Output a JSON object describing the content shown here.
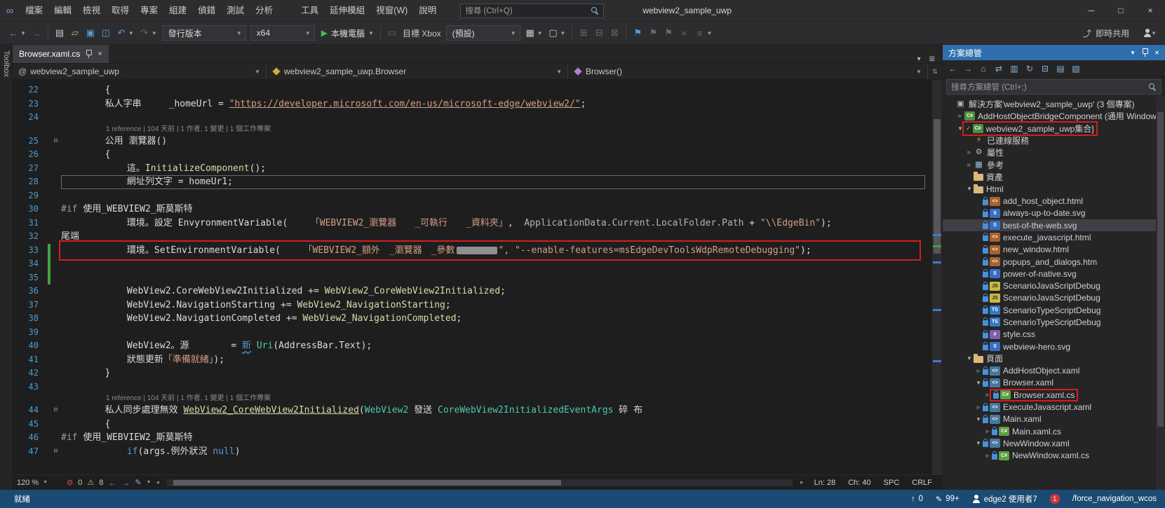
{
  "colors": {
    "annot": "#d21e1e",
    "accent": "#2f6fad",
    "status": "#1b4a74",
    "kw": "#569cd6",
    "str": "#d69d85",
    "typ": "#4ec9b0",
    "mth": "#dcdcaa",
    "run_green": "#3fbf49"
  },
  "titlebar": {
    "title": "webview2_sample_uwp",
    "search": "搜尋 (Ctrl+Q)",
    "menus": [
      {
        "id": "file",
        "label": "檔案"
      },
      {
        "id": "edit",
        "label": "編輯"
      },
      {
        "id": "view",
        "label": "檢視"
      },
      {
        "id": "get",
        "label": "取得"
      },
      {
        "id": "project",
        "label": "專案"
      },
      {
        "id": "build",
        "label": "組建"
      },
      {
        "id": "debug",
        "label": "偵錯"
      },
      {
        "id": "test",
        "label": "測試"
      },
      {
        "id": "analyze",
        "label": "分析"
      },
      {
        "id": "tools",
        "label": "工具",
        "gap": true
      },
      {
        "id": "extensions",
        "label": "延伸模組"
      },
      {
        "id": "window",
        "label": "視窗(W)"
      },
      {
        "id": "help",
        "label": "說明"
      }
    ],
    "window_buttons": {
      "minimize": "─",
      "maximize": "□",
      "close": "×"
    }
  },
  "toolbar": {
    "config": "發行版本",
    "arch": "x64",
    "run_label": "本機電腦",
    "target_label": "目標 Xbox",
    "profile_label": "(預設)",
    "liveshare_label": "即時共用",
    "items": [
      {
        "t": "icon",
        "n": "nav-backward-icon",
        "g": "←",
        "c": "blue"
      },
      {
        "t": "caret"
      },
      {
        "t": "icon",
        "n": "nav-forward-icon",
        "g": "→",
        "c": "dim"
      },
      {
        "t": "sep"
      },
      {
        "t": "icon",
        "n": "new-file-icon",
        "g": "▤",
        "c": ""
      },
      {
        "t": "icon",
        "n": "open-file-icon",
        "g": "▱",
        "c": "tan"
      },
      {
        "t": "icon",
        "n": "save-icon",
        "g": "▣",
        "c": "blue"
      },
      {
        "t": "icon",
        "n": "save-all-icon",
        "g": "◫",
        "c": "blue"
      },
      {
        "t": "icon",
        "n": "undo-icon",
        "g": "↶",
        "c": "blue"
      },
      {
        "t": "caret"
      },
      {
        "t": "icon",
        "n": "redo-icon",
        "g": "↷",
        "c": "dim"
      },
      {
        "t": "caret"
      },
      {
        "t": "combo",
        "n": "solution-configuration-combo",
        "bind": "config",
        "cls": "cfg"
      },
      {
        "t": "combo",
        "n": "solution-platform-combo",
        "bind": "arch",
        "cls": "arch"
      },
      {
        "t": "run",
        "n": "start-debugging-button"
      },
      {
        "t": "caret"
      },
      {
        "t": "sep"
      },
      {
        "t": "icon",
        "n": "deploy-target-icon",
        "g": "▭",
        "c": "dim"
      },
      {
        "t": "label",
        "n": "target-xbox-label",
        "bind": "target_label"
      },
      {
        "t": "combo",
        "n": "debug-profile-combo",
        "bind": "profile_label",
        "cls": "prof"
      },
      {
        "t": "icon",
        "n": "app-toolbar-icon",
        "g": "▦",
        "c": ""
      },
      {
        "t": "caret"
      },
      {
        "t": "icon",
        "n": "capture-icon",
        "g": "▢",
        "c": ""
      },
      {
        "t": "caret"
      },
      {
        "t": "sep"
      },
      {
        "t": "icon",
        "n": "show-diagnostics-icon",
        "g": "⊞",
        "c": "dim"
      },
      {
        "t": "icon",
        "n": "step-tools-icon",
        "g": "⊟",
        "c": "dim"
      },
      {
        "t": "icon",
        "n": "breakpoint-tools-icon",
        "g": "⊠",
        "c": "dim"
      },
      {
        "t": "sep"
      },
      {
        "t": "icon",
        "n": "toggle-bookmark-icon",
        "g": "⚑",
        "c": "blue"
      },
      {
        "t": "icon",
        "n": "prev-bookmark-icon",
        "g": "⚑",
        "c": "dim"
      },
      {
        "t": "icon",
        "n": "next-bookmark-icon",
        "g": "⚑",
        "c": "dim"
      },
      {
        "t": "icon",
        "n": "clear-bookmarks-icon",
        "g": "×",
        "c": "dim"
      },
      {
        "t": "icon",
        "n": "toolbar-options-icon",
        "g": "≡",
        "c": "dim"
      },
      {
        "t": "caret"
      },
      {
        "t": "flex"
      },
      {
        "t": "liveshare",
        "n": "live-share-button"
      },
      {
        "t": "person",
        "n": "account-button"
      },
      {
        "t": "caret"
      }
    ]
  },
  "toolbox_label": "Toolbox",
  "editor": {
    "tab": "Browser.xaml.cs",
    "navbar": [
      "webview2_sample_uwp",
      "webview2_sample_uwp.Browser",
      "Browser()"
    ],
    "nav_at": "@",
    "zoom": "120 %",
    "errors": "0",
    "warnings": "8",
    "ln": "Ln: 28",
    "ch": "Ch: 40",
    "spc": "SPC",
    "eol": "CRLF"
  },
  "code": {
    "rows": [
      {
        "n": "22",
        "seg": [
          [
            "        {",
            "w"
          ]
        ]
      },
      {
        "n": "23",
        "seg": [
          [
            "        私人字串　　　_homeUrl = ",
            "w"
          ],
          [
            "\"https://developer.microsoft.com/en-us/microsoft-edge/webview2/\"",
            "s u"
          ],
          [
            ";",
            "w"
          ]
        ]
      },
      {
        "n": "24",
        "seg": []
      },
      {
        "lens": "1 reference |      104 天前 | 1 作者, 1 變更 | 1 個工作專案"
      },
      {
        "n": "25",
        "fold": true,
        "seg": [
          [
            "        公用 瀏覽器()",
            "w"
          ]
        ]
      },
      {
        "n": "26",
        "seg": [
          [
            "        {",
            "w"
          ]
        ]
      },
      {
        "n": "27",
        "seg": [
          [
            "            這。",
            "w"
          ],
          [
            "InitializeComponent",
            "m"
          ],
          [
            "();",
            "w"
          ]
        ]
      },
      {
        "n": "28",
        "current": true,
        "seg": [
          [
            "            網址列文字 = homeUr1;",
            "w"
          ]
        ]
      },
      {
        "n": "29",
        "seg": []
      },
      {
        "n": "30",
        "seg": [
          [
            "#if ",
            "g"
          ],
          [
            "使用_WEBVIEW2_斯莫斯特",
            "w"
          ]
        ]
      },
      {
        "n": "31",
        "seg": [
          [
            "            環境。設定 EnvyronmentVariable(",
            "w"
          ],
          [
            "　　　「WEBVIEW2_瀏覽器　　_可執行　　_資料夾」",
            "s"
          ],
          [
            ",  ",
            "w"
          ],
          [
            "ApplicationData.Current.LocalFolder.Path",
            "d"
          ],
          [
            " + ",
            "w"
          ],
          [
            "\"\\\\EdgeBin\"",
            "s"
          ],
          [
            ");",
            "w"
          ]
        ]
      },
      {
        "n": "32",
        "seg": [
          [
            "尾端",
            "w"
          ]
        ]
      },
      {
        "n": "33",
        "red": true,
        "green": true,
        "seg": [
          [
            "            環境。SetEnvironmentVariable(",
            "w"
          ],
          [
            "　　　「WEBVIEW2_額外　_瀏覽器　_參數",
            "s"
          ],
          [
            "",
            "redact"
          ],
          [
            "\", ",
            "s"
          ],
          [
            "\"--enable-features=msEdgeDevToolsWdpRemoteDebugging\"",
            "s"
          ],
          [
            ");",
            "w"
          ]
        ]
      },
      {
        "n": "34",
        "green": true,
        "seg": []
      },
      {
        "n": "35",
        "green": true,
        "seg": []
      },
      {
        "n": "36",
        "seg": [
          [
            "            WebView2.CoreWebView2Initialized += ",
            "w"
          ],
          [
            "WebView2_CoreWebView2Initialized",
            "m"
          ],
          [
            ";",
            "w"
          ]
        ]
      },
      {
        "n": "37",
        "seg": [
          [
            "            WebView2.NavigationStarting += ",
            "w"
          ],
          [
            "WebView2_NavigationStarting",
            "m"
          ],
          [
            ";",
            "w"
          ]
        ]
      },
      {
        "n": "38",
        "seg": [
          [
            "            WebView2.NavigationCompleted += ",
            "w"
          ],
          [
            "WebView2_NavigationCompleted",
            "m"
          ],
          [
            ";",
            "w"
          ]
        ]
      },
      {
        "n": "39",
        "seg": []
      },
      {
        "n": "40",
        "seg": [
          [
            "            WebView2。源　　　　 = ",
            "w"
          ],
          [
            "新",
            "k sq"
          ],
          [
            " ",
            "w"
          ],
          [
            "Uri",
            "t"
          ],
          [
            "(AddressBar.Text);",
            "w"
          ]
        ]
      },
      {
        "n": "41",
        "seg": [
          [
            "            狀態更新",
            "w"
          ],
          [
            "「準備就緒」",
            "s"
          ],
          [
            ");",
            "w"
          ]
        ]
      },
      {
        "n": "42",
        "seg": [
          [
            "        }",
            "w"
          ]
        ]
      },
      {
        "n": "43",
        "seg": []
      },
      {
        "lens": "1 reference |      104 天前 | 1 作者, 1 變更 | 1 個工作專案"
      },
      {
        "n": "44",
        "fold": true,
        "seg": [
          [
            "        私人同步處理無效 ",
            "w"
          ],
          [
            "WebView2_CoreWebView2Initialized",
            "m u"
          ],
          [
            "(",
            "w"
          ],
          [
            "WebView2",
            "t"
          ],
          [
            " 發送 ",
            "w"
          ],
          [
            "CoreWebView2InitializedEventArgs",
            "t"
          ],
          [
            " 碎 布",
            "w"
          ]
        ]
      },
      {
        "n": "45",
        "seg": [
          [
            "        {",
            "w"
          ]
        ]
      },
      {
        "n": "46",
        "seg": [
          [
            "#if ",
            "g"
          ],
          [
            "使用_WEBVIEW2_斯莫斯特",
            "w"
          ]
        ]
      },
      {
        "n": "47",
        "fold": true,
        "seg": [
          [
            "            if",
            "k"
          ],
          [
            "(args.例外狀況 ",
            "w"
          ],
          [
            "null",
            "k"
          ],
          [
            ")",
            "w"
          ]
        ]
      }
    ]
  },
  "panel": {
    "header": "方案總管",
    "search_placeholder": "搜尋方案總管 (Ctrl+;)",
    "toolbar_icons": [
      {
        "name": "back-icon",
        "g": "←"
      },
      {
        "name": "forward-icon",
        "g": "→"
      },
      {
        "name": "home-icon",
        "g": "⌂"
      },
      {
        "name": "switch-views-icon",
        "g": "⇄"
      },
      {
        "name": "pending-changes-icon",
        "g": "▥"
      },
      {
        "name": "refresh-icon",
        "g": "↻"
      },
      {
        "name": "collapse-all-icon",
        "g": "⊟"
      },
      {
        "name": "show-all-files-icon",
        "g": "▤"
      },
      {
        "name": "properties-icon",
        "g": "▧"
      }
    ],
    "tree": [
      {
        "label": "解決方案'webview2_sample_uwp' (3 個專案)",
        "indent": 0,
        "icon": "solution"
      },
      {
        "label": "AddHostObjectBridgeComponent (通用 Windows)",
        "indent": 1,
        "icon": "proj",
        "arrow": "c"
      },
      {
        "label": "webview2_sample_uwp集合]",
        "indent": 1,
        "icon": "proj",
        "arrow": "e",
        "red": true,
        "check": true
      },
      {
        "label": "已連線服務",
        "indent": 2,
        "icon": "svc"
      },
      {
        "label": "屬性",
        "indent": 2,
        "icon": "wrench",
        "arrow": "c"
      },
      {
        "label": "參考",
        "indent": 2,
        "icon": "ref",
        "arrow": "c"
      },
      {
        "label": "資產",
        "indent": 2,
        "icon": "folder"
      },
      {
        "label": "Html",
        "indent": 2,
        "icon": "folder",
        "arrow": "e"
      },
      {
        "label": "add_host_object.html",
        "indent": 3,
        "icon": "html",
        "lock": true
      },
      {
        "label": "always-up-to-date.svg",
        "indent": 3,
        "icon": "svg",
        "lock": true
      },
      {
        "label": "best-of-the-web.svg",
        "indent": 3,
        "icon": "svg",
        "lock": true,
        "sel": true
      },
      {
        "label": "execute_javascript.html",
        "indent": 3,
        "icon": "html",
        "lock": true
      },
      {
        "label": "new_window.html",
        "indent": 3,
        "icon": "html",
        "lock": true
      },
      {
        "label": "popups_and_dialogs.htm",
        "indent": 3,
        "icon": "html",
        "lock": true
      },
      {
        "label": "power-of-native.svg",
        "indent": 3,
        "icon": "svg",
        "lock": true
      },
      {
        "label": "ScenarioJavaScriptDebug",
        "indent": 3,
        "icon": "js",
        "lock": true
      },
      {
        "label": "ScenarioJavaScriptDebug",
        "indent": 3,
        "icon": "js",
        "lock": true
      },
      {
        "label": "ScenarioTypeScriptDebug",
        "indent": 3,
        "icon": "ts",
        "lock": true
      },
      {
        "label": "ScenarioTypeScriptDebug",
        "indent": 3,
        "icon": "ts",
        "lock": true
      },
      {
        "label": "style.css",
        "indent": 3,
        "icon": "css",
        "lock": true
      },
      {
        "label": "webview-hero.svg",
        "indent": 3,
        "icon": "svg",
        "lock": true
      },
      {
        "label": "頁面",
        "indent": 2,
        "icon": "folder",
        "arrow": "e"
      },
      {
        "label": "AddHostObject.xaml",
        "indent": 3,
        "icon": "xaml",
        "lock": true,
        "arrow": "c"
      },
      {
        "label": "Browser.xaml",
        "indent": 3,
        "icon": "xaml",
        "lock": true,
        "arrow": "e"
      },
      {
        "label": "Browser.xaml.cs",
        "indent": 4,
        "icon": "cs",
        "lock": true,
        "arrow": "c",
        "red": true
      },
      {
        "label": "ExecuteJavascript.xaml",
        "indent": 3,
        "icon": "xaml",
        "lock": true,
        "arrow": "c"
      },
      {
        "label": "Main.xaml",
        "indent": 3,
        "icon": "xaml",
        "lock": true,
        "arrow": "e"
      },
      {
        "label": "Main.xaml.cs",
        "indent": 4,
        "icon": "cs",
        "lock": true,
        "arrow": "c"
      },
      {
        "label": "NewWindow.xaml",
        "indent": 3,
        "icon": "xaml",
        "lock": true,
        "arrow": "e"
      },
      {
        "label": "NewWindow.xaml.cs",
        "indent": 4,
        "icon": "cs",
        "lock": true,
        "arrow": "c"
      }
    ]
  },
  "statusbar": {
    "ready": "就緒",
    "right": [
      {
        "type": "stat",
        "name": "outgoing-commits",
        "icon": "↑",
        "text": "0"
      },
      {
        "type": "stat",
        "name": "pending-edits",
        "icon": "✎",
        "text": "99+"
      },
      {
        "type": "account",
        "name": "liveshare-session",
        "text": "edge2 使用者7"
      },
      {
        "type": "badge",
        "name": "notification-badge",
        "text": "1"
      },
      {
        "type": "branch",
        "name": "current-branch",
        "text": "/force_navigation_wcos"
      }
    ]
  }
}
